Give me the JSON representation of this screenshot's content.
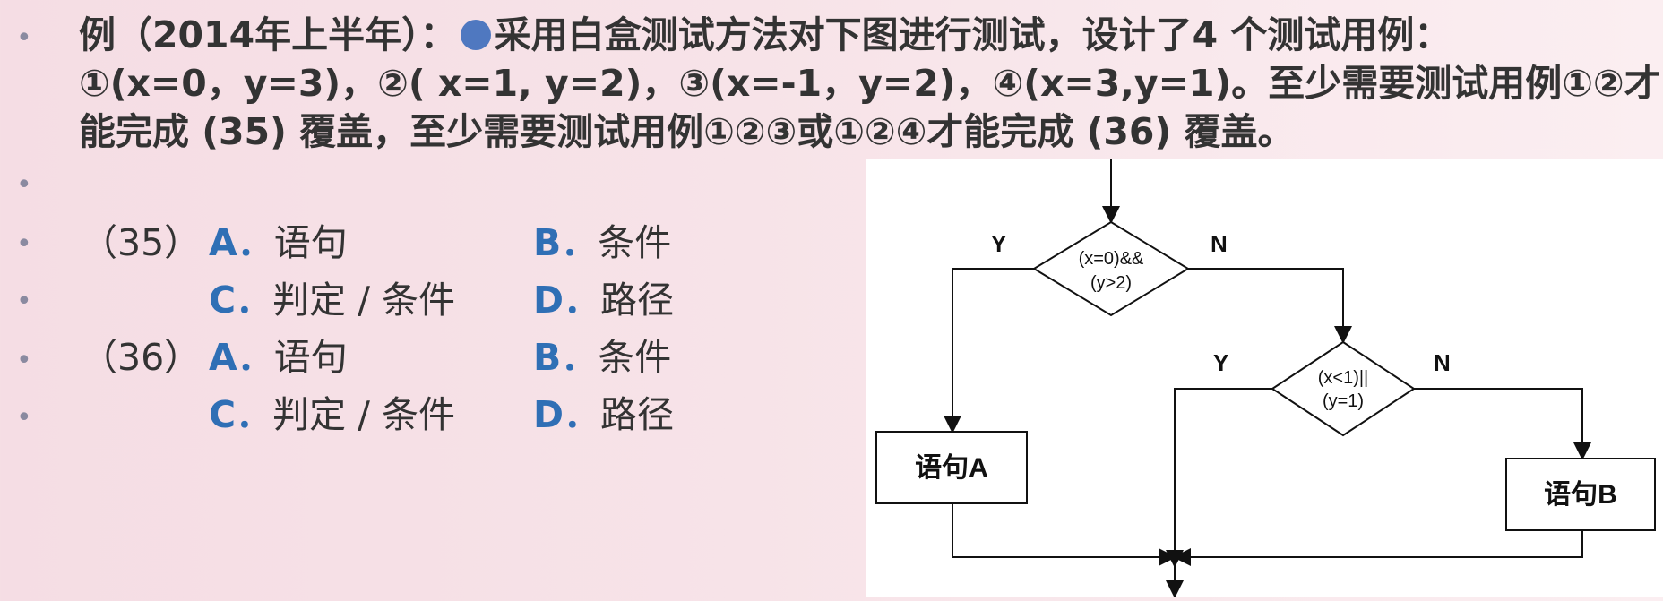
{
  "question": {
    "line1": "例（2014年上半年）：",
    "line1_rest": "采用白盒测试方法对下图进行测试，设计了4 个测试用例：",
    "line2": "①(x=0，y=3)，②( x=1, y=2)，③(x=-1，y=2)，④(x=3,y=1)。至少需要测试用例①②才",
    "line3": "能完成 (35) 覆盖，至少需要测试用例①②③或①②④才能完成 (36) 覆盖。"
  },
  "bullets": [
    "•",
    "•",
    "•",
    "•",
    "•",
    "•"
  ],
  "options": {
    "q35_num": "（35）",
    "q36_num": "（36）",
    "a_label": "A．",
    "a_text": "语句",
    "b_label": "B．",
    "b_text": "条件",
    "c_label": "C．",
    "c_text": "判定 / 条件",
    "d_label": "D．",
    "d_text": "路径"
  },
  "flowchart": {
    "decision1_line1": "(x=0)&&",
    "decision1_line2": "(y>2)",
    "decision2_line1": "(x<1)||",
    "decision2_line2": "(y=1)",
    "yes": "Y",
    "no": "N",
    "stmt_a": "语句A",
    "stmt_b": "语句B"
  },
  "colors": {
    "background": "#f6dfe5",
    "option_label": "#2f6fb5",
    "circle_marker": "#4f78c0",
    "text": "#333333"
  }
}
